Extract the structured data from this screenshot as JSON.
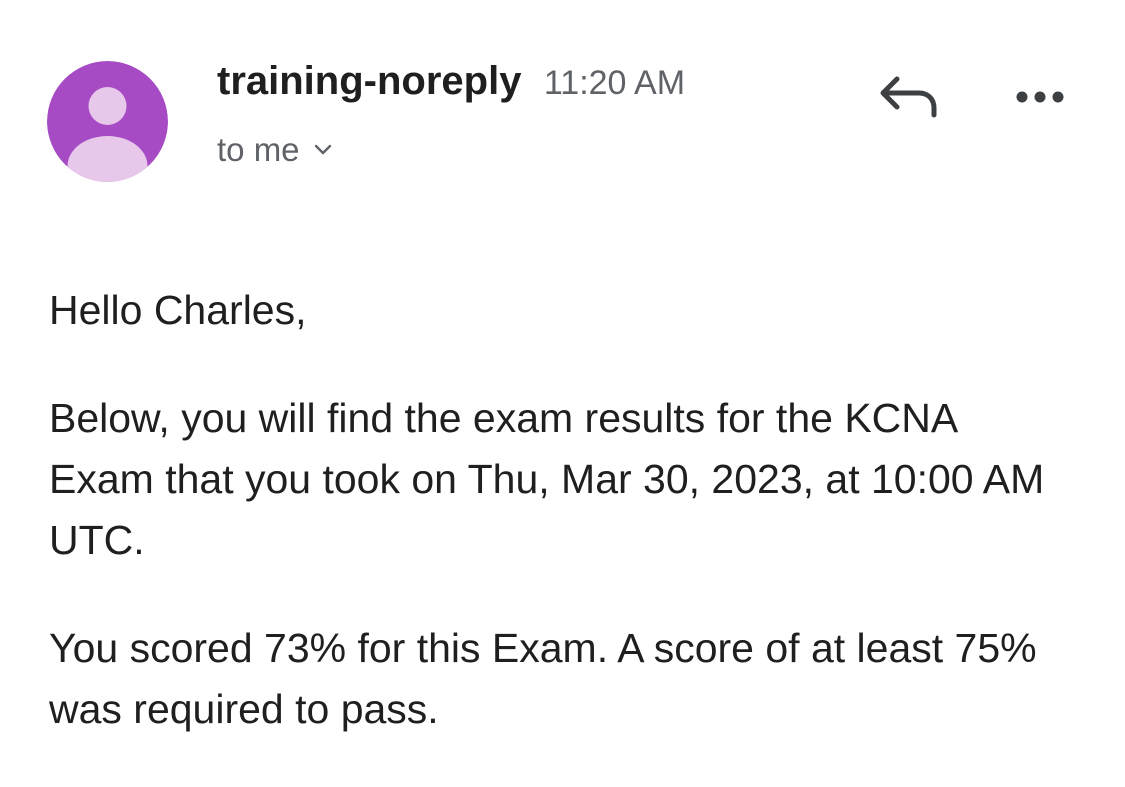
{
  "header": {
    "sender_name": "training-noreply",
    "time": "11:20 AM",
    "recipient": "to me",
    "icons": {
      "avatar": "person-avatar-icon",
      "reply": "reply-arrow-icon",
      "more": "more-options-icon",
      "chevron": "chevron-down-icon"
    },
    "colors": {
      "avatar_bg": "#a64bc4",
      "avatar_fg": "#e7c8ea",
      "secondary_text": "#5f6368"
    }
  },
  "message": {
    "greeting": "Hello Charles,",
    "paragraph_1": "Below, you will find the exam results for the KCNA Exam that you took on Thu, Mar 30, 2023, at 10:00 AM UTC.",
    "paragraph_2": "You scored 73% for this Exam. A score of at least 75% was required to pass."
  }
}
